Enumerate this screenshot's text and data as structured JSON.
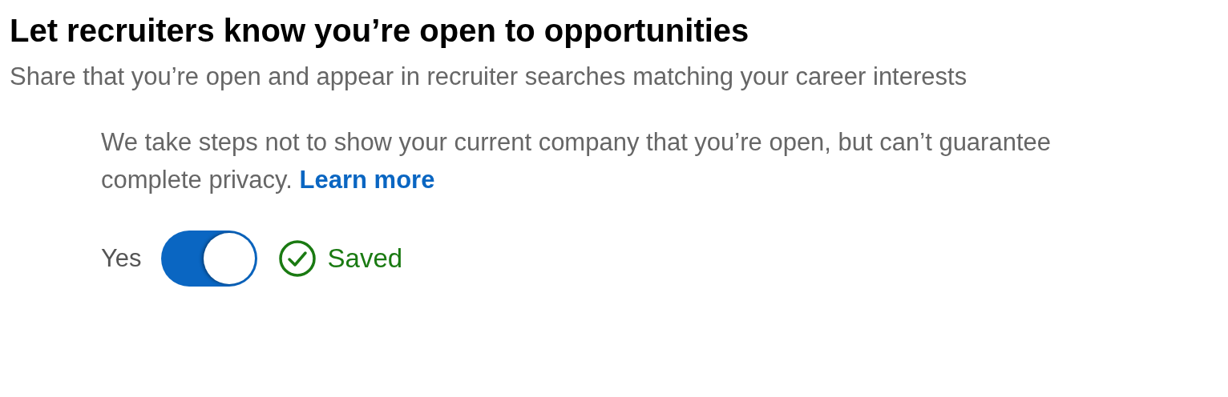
{
  "title": "Let recruiters know you’re open to opportunities",
  "subtitle": "Share that you’re open and appear in recruiter searches matching your career interests",
  "notice": {
    "text": "We take steps not to show your current company that you’re open, but can’t guarantee complete privacy.",
    "link": "Learn more"
  },
  "toggle": {
    "label": "Yes",
    "on": true
  },
  "status": {
    "text": "Saved"
  }
}
